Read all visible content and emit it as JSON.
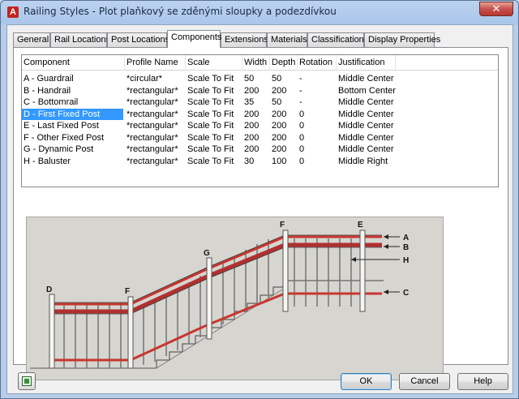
{
  "window": {
    "title": "Railing Styles - Plot plaňkový se zděnými sloupky a podezdívkou",
    "app_icon": "autocad-icon",
    "close_glyph": "✕"
  },
  "tabs": [
    {
      "label": "General"
    },
    {
      "label": "Rail Locations"
    },
    {
      "label": "Post Locations"
    },
    {
      "label": "Components",
      "active": true
    },
    {
      "label": "Extensions"
    },
    {
      "label": "Materials"
    },
    {
      "label": "Classifications"
    },
    {
      "label": "Display Properties"
    }
  ],
  "components": {
    "columns": [
      "Component",
      "Profile Name",
      "Scale",
      "Width",
      "Depth",
      "Rotation",
      "Justification"
    ],
    "rows": [
      [
        "A - Guardrail",
        "*circular*",
        "Scale To Fit",
        "50",
        "50",
        "-",
        "Middle Center"
      ],
      [
        "B - Handrail",
        "*rectangular*",
        "Scale To Fit",
        "200",
        "200",
        "-",
        "Bottom Center"
      ],
      [
        "C - Bottomrail",
        "*rectangular*",
        "Scale To Fit",
        "35",
        "50",
        "-",
        "Middle Center"
      ],
      [
        "D - First Fixed Post",
        "*rectangular*",
        "Scale To Fit",
        "200",
        "200",
        "0",
        "Middle Center"
      ],
      [
        "E - Last Fixed Post",
        "*rectangular*",
        "Scale To Fit",
        "200",
        "200",
        "0",
        "Middle Center"
      ],
      [
        "F - Other Fixed Post",
        "*rectangular*",
        "Scale To Fit",
        "200",
        "200",
        "0",
        "Middle Center"
      ],
      [
        "G - Dynamic Post",
        "*rectangular*",
        "Scale To Fit",
        "200",
        "200",
        "0",
        "Middle Center"
      ],
      [
        "H - Baluster",
        "*rectangular*",
        "Scale To Fit",
        "30",
        "100",
        "0",
        "Middle Right"
      ]
    ],
    "selected_row": 3
  },
  "diagram": {
    "labels": [
      "A",
      "B",
      "H",
      "C",
      "D",
      "F",
      "G",
      "F",
      "E"
    ]
  },
  "buttons": {
    "ok": "OK",
    "cancel": "Cancel",
    "help": "Help",
    "style_icon": "style-editor-icon"
  }
}
